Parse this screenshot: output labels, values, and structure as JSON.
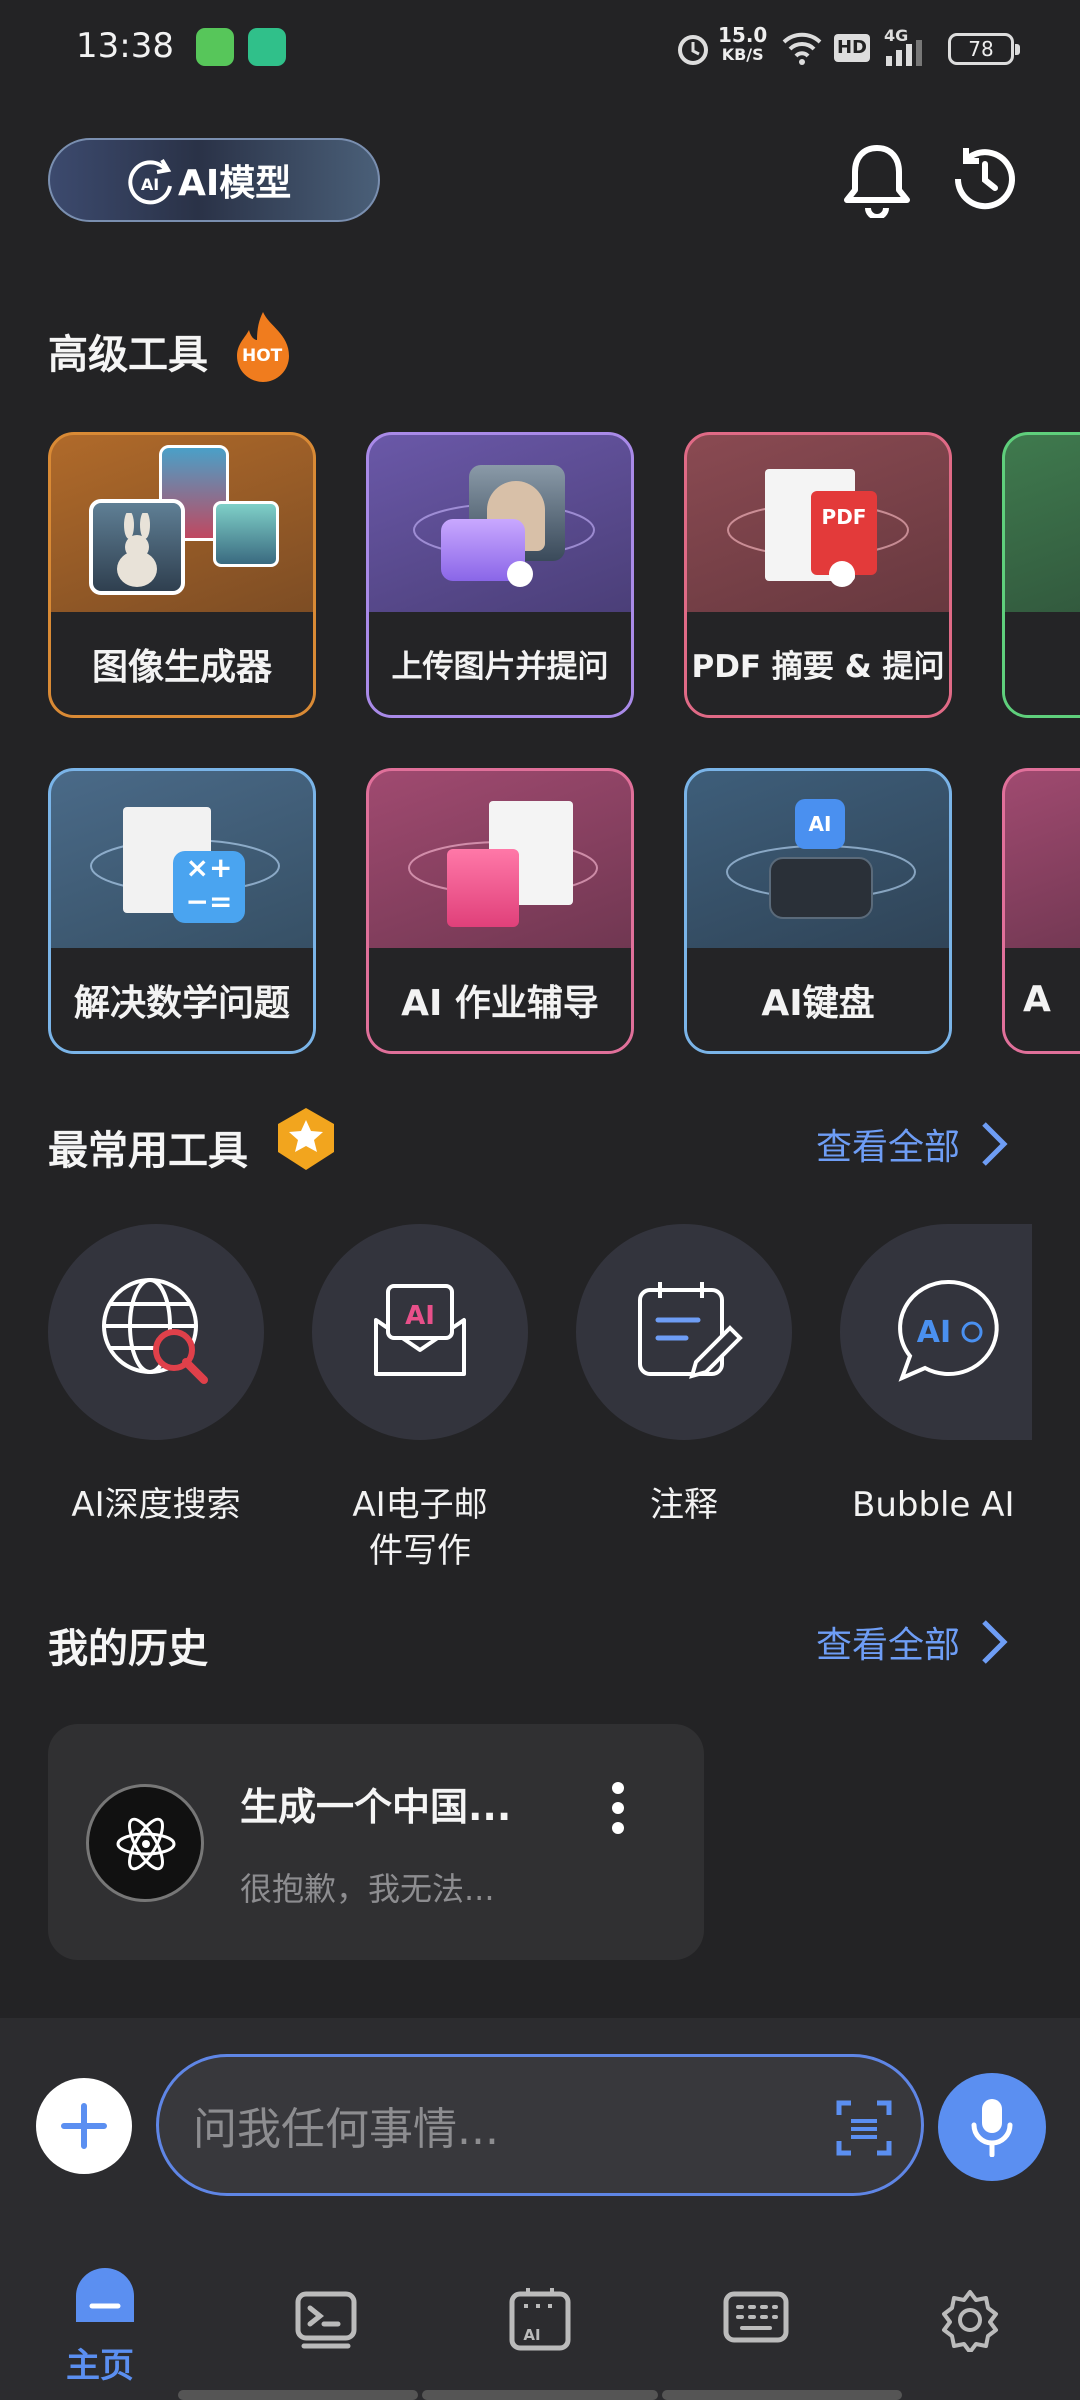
{
  "status_bar": {
    "time": "13:38",
    "net_speed": "15.0",
    "net_unit": "KB/S",
    "hd": "HD",
    "signal": "4G",
    "battery": "78"
  },
  "header": {
    "model_button": "AI模型"
  },
  "advanced_tools": {
    "title": "高级工具",
    "hot_badge": "HOT",
    "cards": [
      {
        "label": "图像生成器",
        "accent": "#d98a35"
      },
      {
        "label": "上传图片并提问",
        "accent": "#a98ae8"
      },
      {
        "label": "PDF 摘要 & 提问",
        "accent": "#e06a86"
      },
      {
        "label": "",
        "accent": "#5fcf7c"
      },
      {
        "label": "解决数学问题",
        "accent": "#7ab4e8"
      },
      {
        "label": "AI 作业辅导",
        "accent": "#e0709a"
      },
      {
        "label": "AI键盘",
        "accent": "#7ab4e8"
      },
      {
        "label": "A",
        "accent": "#e0709a"
      }
    ]
  },
  "common_tools": {
    "title": "最常用工具",
    "see_all": "查看全部",
    "items": [
      {
        "label": "AI深度搜索",
        "icon": "globe-search-icon"
      },
      {
        "label": "AI电子邮件写作",
        "icon": "ai-mail-icon"
      },
      {
        "label": "注释",
        "icon": "notepad-pencil-icon"
      },
      {
        "label": "Bubble AI",
        "icon": "ai-chat-bubble-icon"
      }
    ]
  },
  "history": {
    "title": "我的历史",
    "see_all": "查看全部",
    "items": [
      {
        "title": "生成一个中国...",
        "preview": "很抱歉，我无法..."
      }
    ]
  },
  "composer": {
    "placeholder": "问我任何事情..."
  },
  "bottom_nav": {
    "items": [
      {
        "label": "主页",
        "icon": "home-icon",
        "active": true
      },
      {
        "label": "",
        "icon": "terminal-icon"
      },
      {
        "label": "",
        "icon": "ai-keyboard-icon"
      },
      {
        "label": "",
        "icon": "keyboard-icon"
      },
      {
        "label": "",
        "icon": "settings-gear-icon"
      }
    ]
  },
  "colors": {
    "background": "#232325",
    "accent_blue": "#5b8ff1",
    "link_blue": "#6e9df5"
  }
}
